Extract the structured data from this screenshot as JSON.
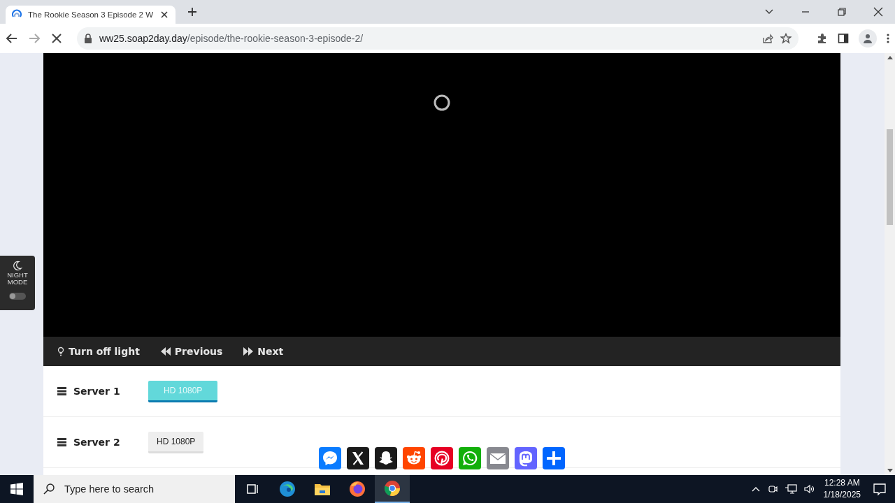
{
  "browser": {
    "tabs": [
      {
        "title": "The Rookie Season 3 Episode 2 W",
        "selected": true
      }
    ],
    "url_host": "ww25.soap2day.day",
    "url_path": "/episode/the-rookie-season-3-episode-2/"
  },
  "night_mode": {
    "label": "NIGHT MODE",
    "on": false
  },
  "player_controls": [
    {
      "kind": "light",
      "label": "Turn off light"
    },
    {
      "kind": "previous",
      "label": "Previous"
    },
    {
      "kind": "next",
      "label": "Next"
    }
  ],
  "servers": [
    {
      "name": "Server 1",
      "options": [
        {
          "label": "HD 1080P",
          "selected": true
        }
      ]
    },
    {
      "name": "Server 2",
      "options": [
        {
          "label": "HD 1080P",
          "selected": false
        }
      ]
    }
  ],
  "share_buttons": [
    {
      "kind": "messenger",
      "color": "#0a7cff"
    },
    {
      "kind": "x",
      "color": "#1a1a1a"
    },
    {
      "kind": "snapchat",
      "color": "#1a1a1a"
    },
    {
      "kind": "reddit",
      "color": "#ff4500"
    },
    {
      "kind": "pinterest",
      "color": "#e60023"
    },
    {
      "kind": "whatsapp",
      "color": "#12af0a"
    },
    {
      "kind": "email",
      "color": "#888990"
    },
    {
      "kind": "mastodon",
      "color": "#6364ff"
    },
    {
      "kind": "more",
      "color": "#0166ff"
    }
  ],
  "taskbar": {
    "search_placeholder": "Type here to search",
    "apps": [
      {
        "kind": "taskview",
        "selected": false
      },
      {
        "kind": "edge",
        "selected": false
      },
      {
        "kind": "files",
        "selected": false
      },
      {
        "kind": "firefox",
        "selected": false
      },
      {
        "kind": "chrome",
        "selected": true
      }
    ],
    "time": "12:28 AM",
    "date": "1/18/2025"
  }
}
